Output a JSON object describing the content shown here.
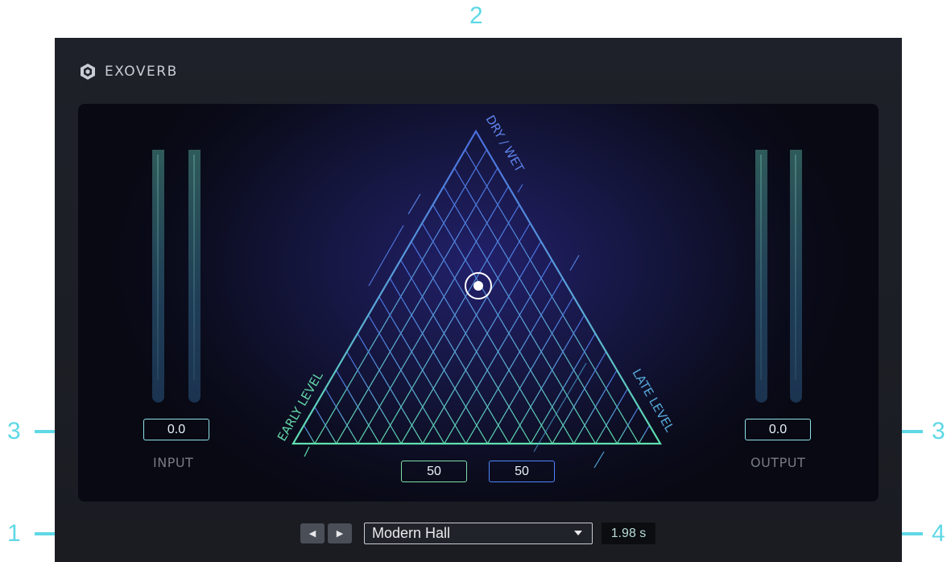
{
  "callouts": {
    "left_bottom": "1",
    "top": "2",
    "left_mid": "3",
    "right_mid": "3",
    "right_bottom": "4"
  },
  "app": {
    "name": "EXOVERB",
    "logo_icon": "exoverb-logo-icon"
  },
  "input": {
    "value": "0.0",
    "label": "INPUT"
  },
  "output": {
    "value": "0.0",
    "label": "OUTPUT"
  },
  "triangle": {
    "top_label": "DRY / WET",
    "left_label": "EARLY LEVEL",
    "right_label": "LATE LEVEL",
    "early_value": "50",
    "late_value": "50"
  },
  "preset": {
    "prev_icon": "triangle-left-icon",
    "next_icon": "triangle-right-icon",
    "name": "Modern Hall",
    "decay": "1.98 s"
  },
  "colors": {
    "callout": "#5fd8e6",
    "early_accent": "#7fe0a8",
    "late_accent": "#4f86ff",
    "grid_top": "#4a6fe0",
    "grid_bottom": "#5fe0b0"
  }
}
